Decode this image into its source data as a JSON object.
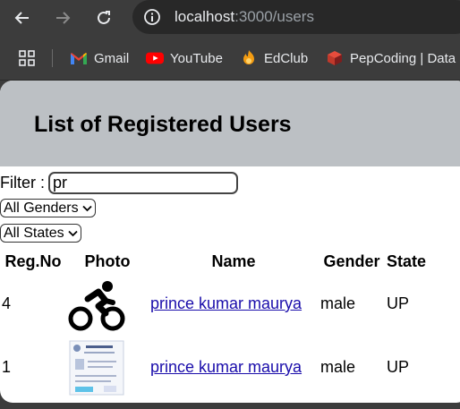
{
  "browser": {
    "url_host": "localhost",
    "url_path": ":3000/users",
    "bookmarks": [
      {
        "label": "Gmail",
        "icon": "gmail-icon"
      },
      {
        "label": "YouTube",
        "icon": "youtube-icon"
      },
      {
        "label": "EdClub",
        "icon": "edclub-icon"
      },
      {
        "label": "PepCoding | Data S",
        "icon": "pepcoding-icon"
      }
    ]
  },
  "page": {
    "title": "List of Registered Users",
    "filter_label": "Filter :",
    "filter_value": "pr",
    "gender_select": "All Genders",
    "state_select": "All States"
  },
  "table": {
    "headers": [
      "Reg.No",
      "Photo",
      "Name",
      "Gender",
      "State"
    ],
    "rows": [
      {
        "regno": "4",
        "photo": "cyclist-icon",
        "name": "prince kumar maurya",
        "gender": "male",
        "state": "UP"
      },
      {
        "regno": "1",
        "photo": "document-thumbnail",
        "name": "prince kumar maurya",
        "gender": "male",
        "state": "UP"
      }
    ]
  },
  "colors": {
    "header_bg": "#bcc0c4",
    "link": "#1a0dab",
    "chrome_bg": "#3c3c3c"
  }
}
